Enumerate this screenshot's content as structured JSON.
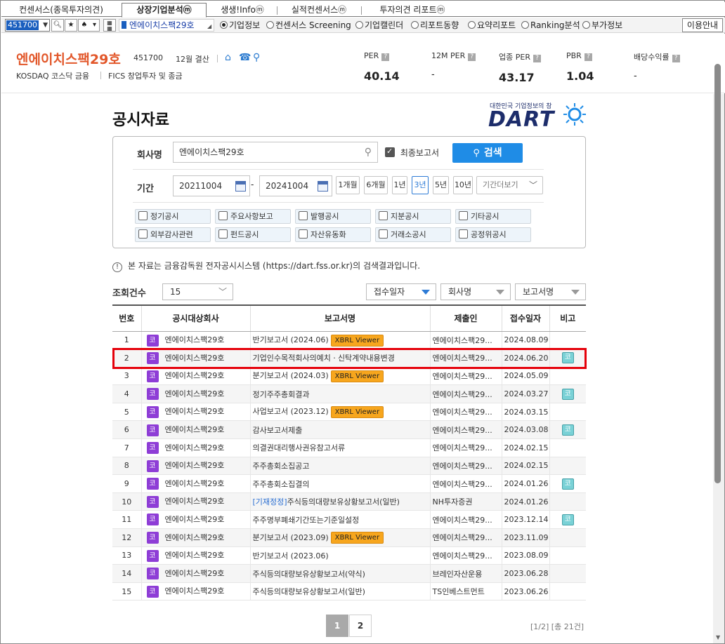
{
  "tabs": [
    {
      "label": "컨센서스(종목투자의견)"
    },
    {
      "label": "상장기업분석ⓜ"
    },
    {
      "label": "생생!Infoⓜ"
    },
    {
      "label": "실적컨센서스ⓜ"
    },
    {
      "label": "투자의견 리포트ⓜ"
    }
  ],
  "toolbar": {
    "stock_code": "451700",
    "company": "엔에이치스팩29호",
    "radios": [
      {
        "label": "기업정보",
        "selected": true
      },
      {
        "label": "컨센서스 Screening",
        "selected": false
      },
      {
        "label": "기업캘린더",
        "selected": false
      },
      {
        "label": "리포트동향",
        "selected": false
      },
      {
        "label": "요약리포트",
        "selected": false
      },
      {
        "label": "Ranking분석",
        "selected": false
      },
      {
        "label": "부가정보",
        "selected": false
      }
    ],
    "help_label": "이용안내"
  },
  "header": {
    "name": "엔에이치스팩29호",
    "code": "451700",
    "fiscal": "12월 결산",
    "market": "KOSDAQ  코스닥 금융",
    "industry": "FICS 창업투자 및 종금",
    "metrics": [
      {
        "label": "PER",
        "value": "40.14"
      },
      {
        "label": "12M PER",
        "value": "-"
      },
      {
        "label": "업종 PER",
        "value": "43.17"
      },
      {
        "label": "PBR",
        "value": "1.04"
      },
      {
        "label": "배당수익률",
        "value": "-"
      }
    ]
  },
  "page": {
    "title": "공시자료",
    "dart_tagline": "대한민국 기업정보의 창",
    "dart_logo": "DART"
  },
  "search": {
    "company_label": "회사명",
    "company_value": "엔에이치스팩29호",
    "final_report_label": "최종보고서",
    "final_report_checked": true,
    "button_label": "검색",
    "period_label": "기간",
    "date_from": "20211004",
    "date_to": "20241004",
    "date_sep": "-",
    "periods": [
      {
        "label": "1개월",
        "active": false
      },
      {
        "label": "6개월",
        "active": false
      },
      {
        "label": "1년",
        "active": false
      },
      {
        "label": "3년",
        "active": true
      },
      {
        "label": "5년",
        "active": false
      },
      {
        "label": "10년",
        "active": false
      }
    ],
    "more_period": "기간더보기",
    "types": [
      "정기공시",
      "주요사항보고",
      "발행공시",
      "지분공시",
      "기타공시",
      "외부감사관련",
      "펀드공시",
      "자산유동화",
      "거래소공시",
      "공정위공시"
    ]
  },
  "notice": "본 자료는 금융감독원 전자공시시스템 (https://dart.fss.or.kr)의 검색결과입니다.",
  "list_controls": {
    "count_label": "조회건수",
    "count_value": "15",
    "sort_date": "접수일자",
    "sort_company": "회사명",
    "sort_report": "보고서명"
  },
  "table": {
    "headers": [
      "번호",
      "공시대상회사",
      "보고서명",
      "제출인",
      "접수일자",
      "비고"
    ],
    "company_badge": "코",
    "xbrl_label": "XBRL Viewer",
    "note_badge": "코",
    "rows": [
      {
        "no": "1",
        "company": "엔에이치스팩29호",
        "prefix": "",
        "report": "반기보고서 (2024.06)",
        "xbrl": true,
        "filer": "엔에이치스팩29...",
        "date": "2024.08.09",
        "note": false
      },
      {
        "no": "2",
        "company": "엔에이치스팩29호",
        "prefix": "",
        "report": "기업인수목적회사의예치ㆍ신탁계약내용변경",
        "xbrl": false,
        "filer": "엔에이치스팩29...",
        "date": "2024.06.20",
        "note": true
      },
      {
        "no": "3",
        "company": "엔에이치스팩29호",
        "prefix": "",
        "report": "분기보고서 (2024.03)",
        "xbrl": true,
        "filer": "엔에이치스팩29...",
        "date": "2024.05.09",
        "note": false
      },
      {
        "no": "4",
        "company": "엔에이치스팩29호",
        "prefix": "",
        "report": "정기주주총회결과",
        "xbrl": false,
        "filer": "엔에이치스팩29...",
        "date": "2024.03.27",
        "note": true
      },
      {
        "no": "5",
        "company": "엔에이치스팩29호",
        "prefix": "",
        "report": "사업보고서 (2023.12)",
        "xbrl": true,
        "filer": "엔에이치스팩29...",
        "date": "2024.03.15",
        "note": false
      },
      {
        "no": "6",
        "company": "엔에이치스팩29호",
        "prefix": "",
        "report": "감사보고서제출",
        "xbrl": false,
        "filer": "엔에이치스팩29...",
        "date": "2024.03.08",
        "note": true
      },
      {
        "no": "7",
        "company": "엔에이치스팩29호",
        "prefix": "",
        "report": "의결권대리행사권유참고서류",
        "xbrl": false,
        "filer": "엔에이치스팩29...",
        "date": "2024.02.15",
        "note": false
      },
      {
        "no": "8",
        "company": "엔에이치스팩29호",
        "prefix": "",
        "report": "주주총회소집공고",
        "xbrl": false,
        "filer": "엔에이치스팩29...",
        "date": "2024.02.15",
        "note": false
      },
      {
        "no": "9",
        "company": "엔에이치스팩29호",
        "prefix": "",
        "report": "주주총회소집결의",
        "xbrl": false,
        "filer": "엔에이치스팩29...",
        "date": "2024.01.26",
        "note": true
      },
      {
        "no": "10",
        "company": "엔에이치스팩29호",
        "prefix": "[기재정정]",
        "report": "주식등의대량보유상황보고서(일반)",
        "xbrl": false,
        "filer": "NH투자증권",
        "date": "2024.01.26",
        "note": false
      },
      {
        "no": "11",
        "company": "엔에이치스팩29호",
        "prefix": "",
        "report": "주주명부폐쇄기간또는기준일설정",
        "xbrl": false,
        "filer": "엔에이치스팩29...",
        "date": "2023.12.14",
        "note": true
      },
      {
        "no": "12",
        "company": "엔에이치스팩29호",
        "prefix": "",
        "report": "분기보고서 (2023.09)",
        "xbrl": true,
        "filer": "엔에이치스팩29...",
        "date": "2023.11.09",
        "note": false
      },
      {
        "no": "13",
        "company": "엔에이치스팩29호",
        "prefix": "",
        "report": "반기보고서 (2023.06)",
        "xbrl": false,
        "filer": "엔에이치스팩29...",
        "date": "2023.08.09",
        "note": false
      },
      {
        "no": "14",
        "company": "엔에이치스팩29호",
        "prefix": "",
        "report": "주식등의대량보유상황보고서(약식)",
        "xbrl": false,
        "filer": "브레인자산운용",
        "date": "2023.06.28",
        "note": false
      },
      {
        "no": "15",
        "company": "엔에이치스팩29호",
        "prefix": "",
        "report": "주식등의대량보유상황보고서(일반)",
        "xbrl": false,
        "filer": "TS인베스트먼트",
        "date": "2023.06.26",
        "note": false
      }
    ]
  },
  "pagination": {
    "pages": [
      "1",
      "2"
    ],
    "current": "1",
    "info": "[1/2] [총 21건]"
  },
  "colors": {
    "accent": "#1f8ce6",
    "brand_orange": "#e2572a",
    "badge_purple": "#8e3dd6",
    "xbrl_orange": "#f7a61d",
    "highlight_red": "#e5000a"
  }
}
